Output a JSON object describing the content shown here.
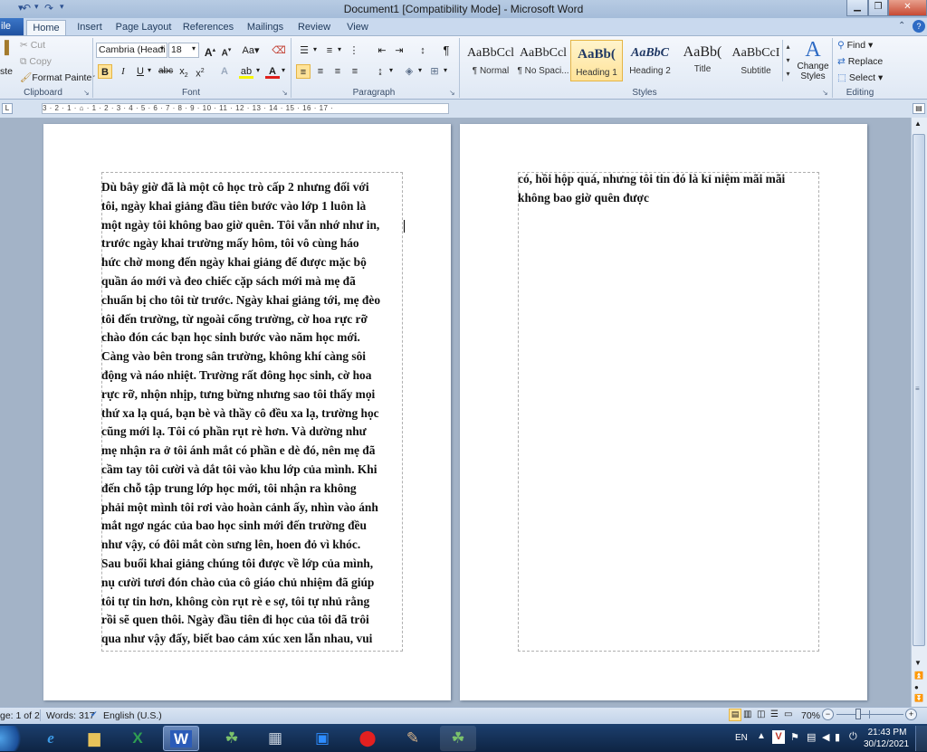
{
  "app": {
    "title": "Document1 [Compatibility Mode] - Microsoft Word"
  },
  "qat": {
    "save_icon": "save-icon",
    "undo_icon": "undo-icon",
    "redo_icon": "redo-icon"
  },
  "window": {
    "minimize_icon": "minimize-icon",
    "restore_icon": "restore-icon",
    "close_icon": "close-icon"
  },
  "tabs": [
    "ile",
    "Home",
    "Insert",
    "Page Layout",
    "References",
    "Mailings",
    "Review",
    "View"
  ],
  "clipboard": {
    "cut": "Cut",
    "copy": "Copy",
    "format_painter": "Format Painter",
    "paste": "ste",
    "label": "Clipboard"
  },
  "font": {
    "name": "Cambria (Headi",
    "size": "18",
    "label": "Font"
  },
  "paragraph": {
    "label": "Paragraph"
  },
  "styles": {
    "label": "Styles",
    "items": [
      {
        "sample": "AaBbCcl",
        "name": "¶ Normal"
      },
      {
        "sample": "AaBbCcl",
        "name": "¶ No Spaci..."
      },
      {
        "sample": "AaBb(",
        "name": "Heading 1"
      },
      {
        "sample": "AaBbC",
        "name": "Heading 2"
      },
      {
        "sample": "AaBb(",
        "name": "Title"
      },
      {
        "sample": "AaBbCcI",
        "name": "Subtitle"
      }
    ],
    "change": "Change Styles"
  },
  "editing": {
    "find": "Find",
    "replace": "Replace",
    "select": "Select",
    "label": "Editing"
  },
  "ruler": {
    "text": "3 · 2 · 1 · ⌂ · 1 · 2 · 3 · 4 · 5 · 6 · 7 · 8 · 9 · 10 · 11 · 12 · 13 · 14 · 15 · 16 · 17 ·"
  },
  "document": {
    "page1_lines": [
      "Dù bây giờ đã là một cô học trò cấp 2 nhưng đối với",
      "tôi, ngày khai giảng đầu tiên bước vào lớp 1 luôn là",
      "một ngày tôi không bao giờ quên. Tôi vẫn nhớ như in,",
      "trước ngày khai trường mấy hôm, tôi vô cùng háo",
      "hức chờ mong đến ngày khai giảng để được mặc bộ",
      "quần áo mới và đeo chiếc cặp sách mới mà mẹ đã",
      "chuẩn bị cho tôi từ trước. Ngày khai giảng tới, mẹ đèo",
      "tôi đến trường, từ ngoài cổng trường, cờ hoa rực rỡ",
      "chào đón các bạn học sinh bước vào năm học mới.",
      "Càng vào bên trong sân trường, không khí càng sôi",
      "động và náo nhiệt.  Trường rất đông học sinh, cờ hoa",
      "rực rỡ, nhộn nhịp, tưng bừng nhưng sao tôi thấy mọi",
      "thứ xa lạ quá, bạn bè và thầy cô đều xa lạ, trường học",
      "cũng mới lạ. Tôi có phần rụt rè hơn. Và dường như",
      "mẹ nhận ra ở tôi ánh mắt có phần e dè đó, nên mẹ đã",
      "cầm tay  tôi cười và dắt tôi vào khu lớp của mình. Khi",
      "đến chỗ tập trung lớp học mới, tôi nhận ra không",
      "phải một mình tôi rơi vào hoàn cảnh ấy, nhìn vào ánh",
      "mắt ngơ ngác của bao học sinh mới đến trường đều",
      "như vậy, có đôi mắt còn sưng lên, hoen đỏ vì khóc.",
      "Sau buổi khai giảng chúng tôi được về lớp của mình,",
      "nụ cười tươi đón chào của cô giáo chủ nhiệm đã giúp",
      "tôi tự tin hơn, không còn rụt rè e sợ, tôi tự nhủ rằng",
      "rồi sẽ quen thôi. Ngày đầu tiên đi học của tôi đã trôi",
      "qua như vậy đấy, biết bao cảm xúc xen lẫn nhau, vui"
    ],
    "page2_lines": [
      "có, hồi hộp quá, nhưng tôi tin đó là kỉ niệm mãi mãi",
      "không bao giờ quên được"
    ]
  },
  "status": {
    "page": "ge: 1 of 2",
    "words": "Words: 317",
    "language": "English (U.S.)",
    "zoom": "70%"
  },
  "taskbar": {
    "apps": [
      "ie-icon",
      "explorer-icon",
      "excel-icon",
      "word-icon",
      "app-icon",
      "calculator-icon",
      "zoom-icon",
      "record-icon",
      "paint-icon",
      "app-icon-2"
    ],
    "lang": "EN",
    "time": "21:43 PM",
    "date": "30/12/2021"
  }
}
